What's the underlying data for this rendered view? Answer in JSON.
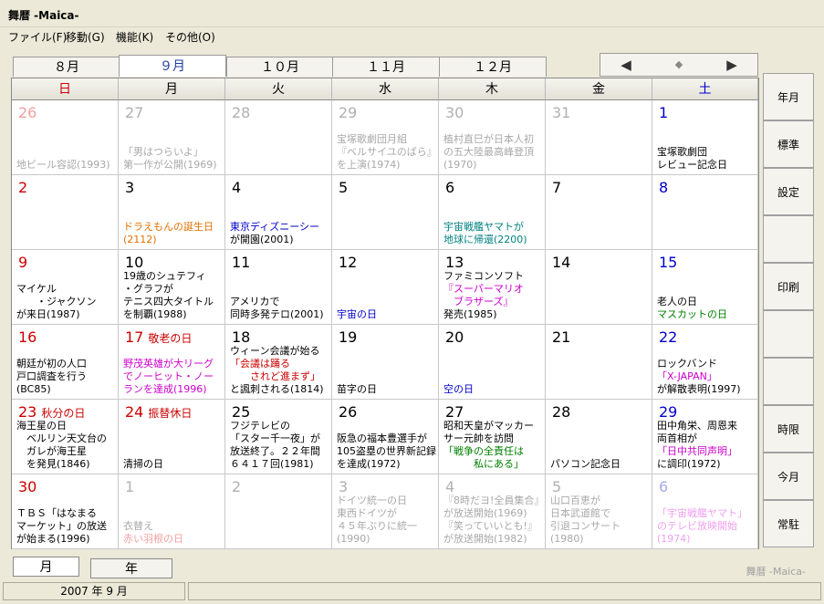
{
  "window": {
    "title": "舞暦 -Maica-"
  },
  "menu": [
    "ファイル(F)",
    "移動(G)",
    "機能(K)",
    "その他(O)"
  ],
  "month_tabs": [
    "８月",
    "９月",
    "１０月",
    "１１月",
    "１２月"
  ],
  "active_month_index": 1,
  "nav": {
    "prev": "◀",
    "updown": "◆",
    "next": "▶"
  },
  "weekdays": [
    "日",
    "月",
    "火",
    "水",
    "木",
    "金",
    "土"
  ],
  "weekday_colors": [
    "#cc0000",
    "#000000",
    "#000000",
    "#000000",
    "#000000",
    "#000000",
    "#0000cc"
  ],
  "cells": [
    {
      "day": "26",
      "label": "",
      "dim": true,
      "numcolor": "#f0a0a0",
      "events": [
        {
          "text": "地ビール容認(1993)",
          "color": "#a8a8a8"
        }
      ]
    },
    {
      "day": "27",
      "label": "",
      "dim": true,
      "numcolor": "#b0b0b0",
      "events": [
        {
          "text": "「男はつらいよ」\n第一作が公開(1969)",
          "color": "#a8a8a8"
        }
      ]
    },
    {
      "day": "28",
      "label": "",
      "dim": true,
      "numcolor": "#b0b0b0",
      "events": []
    },
    {
      "day": "29",
      "label": "",
      "dim": true,
      "numcolor": "#b0b0b0",
      "events": [
        {
          "text": "宝塚歌劇団月組\n『ベルサイユのばら』\nを上演(1974)",
          "color": "#a8a8a8"
        }
      ]
    },
    {
      "day": "30",
      "label": "",
      "dim": true,
      "numcolor": "#b0b0b0",
      "events": [
        {
          "text": "植村直巳が日本人初\nの五大陸最高峰登頂\n(1970)",
          "color": "#a8a8a8"
        }
      ]
    },
    {
      "day": "31",
      "label": "",
      "dim": true,
      "numcolor": "#b0b0b0",
      "events": []
    },
    {
      "day": "1",
      "label": "",
      "dim": false,
      "numcolor": "#0000cc",
      "events": [
        {
          "text": "宝塚歌劇団\nレビュー記念日",
          "color": "#000000"
        }
      ]
    },
    {
      "day": "2",
      "label": "",
      "dim": false,
      "numcolor": "#cc0000",
      "events": []
    },
    {
      "day": "3",
      "label": "",
      "dim": false,
      "numcolor": "#000000",
      "events": [
        {
          "text": "ドラえもんの誕生日\n(2112)",
          "color": "#e07000"
        }
      ]
    },
    {
      "day": "4",
      "label": "",
      "dim": false,
      "numcolor": "#000000",
      "events": [
        {
          "text": "東京ディズニーシー",
          "color": "#0000cc"
        },
        {
          "text": "が開園(2001)",
          "color": "#000000"
        }
      ]
    },
    {
      "day": "5",
      "label": "",
      "dim": false,
      "numcolor": "#000000",
      "events": []
    },
    {
      "day": "6",
      "label": "",
      "dim": false,
      "numcolor": "#000000",
      "events": [
        {
          "text": "宇宙戦艦ヤマトが\n地球に帰還(2200)",
          "color": "#008080"
        }
      ]
    },
    {
      "day": "7",
      "label": "",
      "dim": false,
      "numcolor": "#000000",
      "events": []
    },
    {
      "day": "8",
      "label": "",
      "dim": false,
      "numcolor": "#0000cc",
      "events": []
    },
    {
      "day": "9",
      "label": "",
      "dim": false,
      "numcolor": "#cc0000",
      "events": [
        {
          "text": "マイケル\n　　・ジャクソン\nが来日(1987)",
          "color": "#000000"
        }
      ]
    },
    {
      "day": "10",
      "label": "",
      "dim": false,
      "numcolor": "#000000",
      "events": [
        {
          "text": "19歳のシュテフィ\n・グラフが\nテニス四大タイトル\nを制覇(1988)",
          "color": "#000000"
        }
      ]
    },
    {
      "day": "11",
      "label": "",
      "dim": false,
      "numcolor": "#000000",
      "events": [
        {
          "text": "アメリカで\n同時多発テロ(2001)",
          "color": "#000000"
        }
      ]
    },
    {
      "day": "12",
      "label": "",
      "dim": false,
      "numcolor": "#000000",
      "events": [
        {
          "text": "宇宙の日",
          "color": "#0000cc"
        }
      ]
    },
    {
      "day": "13",
      "label": "",
      "dim": false,
      "numcolor": "#000000",
      "events": [
        {
          "text": "ファミコンソフト",
          "color": "#000000"
        },
        {
          "text": "『スーパーマリオ\n　ブラザーズ』",
          "color": "#cc00cc"
        },
        {
          "text": "発売(1985)",
          "color": "#000000"
        }
      ]
    },
    {
      "day": "14",
      "label": "",
      "dim": false,
      "numcolor": "#000000",
      "events": []
    },
    {
      "day": "15",
      "label": "",
      "dim": false,
      "numcolor": "#0000cc",
      "events": [
        {
          "text": "老人の日",
          "color": "#000000"
        },
        {
          "text": "マスカットの日",
          "color": "#008000"
        }
      ]
    },
    {
      "day": "16",
      "label": "",
      "dim": false,
      "numcolor": "#cc0000",
      "events": [
        {
          "text": "朝廷が初の人口\n戸口調査を行う\n(BC85)",
          "color": "#000000"
        }
      ]
    },
    {
      "day": "17",
      "label": "敬老の日",
      "dim": false,
      "numcolor": "#cc0000",
      "events": [
        {
          "text": "野茂英雄が大リーグ\nでノーヒット・ノー\nランを達成(1996)",
          "color": "#cc00cc"
        }
      ]
    },
    {
      "day": "18",
      "label": "",
      "dim": false,
      "numcolor": "#000000",
      "events": [
        {
          "text": "ウィーン会議が始る",
          "color": "#000000"
        },
        {
          "text": "「会議は踊る\n　　されど進まず」",
          "color": "#cc0000"
        },
        {
          "text": "と諷刺される(1814)",
          "color": "#000000"
        }
      ]
    },
    {
      "day": "19",
      "label": "",
      "dim": false,
      "numcolor": "#000000",
      "events": [
        {
          "text": "苗字の日",
          "color": "#000000"
        }
      ]
    },
    {
      "day": "20",
      "label": "",
      "dim": false,
      "numcolor": "#000000",
      "events": [
        {
          "text": "空の日",
          "color": "#0000cc"
        }
      ]
    },
    {
      "day": "21",
      "label": "",
      "dim": false,
      "numcolor": "#000000",
      "events": []
    },
    {
      "day": "22",
      "label": "",
      "dim": false,
      "numcolor": "#0000cc",
      "events": [
        {
          "text": "ロックバンド",
          "color": "#000000"
        },
        {
          "text": "「X-JAPAN」",
          "color": "#cc00cc"
        },
        {
          "text": "が解散表明(1997)",
          "color": "#000000"
        }
      ]
    },
    {
      "day": "23",
      "label": "秋分の日",
      "dim": false,
      "numcolor": "#cc0000",
      "events": [
        {
          "text": "海王星の日\n　ベルリン天文台の\n　ガレが海王星\n　を発見(1846)",
          "color": "#000000"
        }
      ]
    },
    {
      "day": "24",
      "label": "振替休日",
      "dim": false,
      "numcolor": "#cc0000",
      "events": [
        {
          "text": "清掃の日",
          "color": "#000000"
        }
      ]
    },
    {
      "day": "25",
      "label": "",
      "dim": false,
      "numcolor": "#000000",
      "events": [
        {
          "text": "フジテレビの\n「スター千一夜」が\n放送終了。２２年間\n６４１７回(1981)",
          "color": "#000000"
        }
      ]
    },
    {
      "day": "26",
      "label": "",
      "dim": false,
      "numcolor": "#000000",
      "events": [
        {
          "text": "阪急の福本豊選手が\n105盗塁の世界新記録\nを達成(1972)",
          "color": "#000000"
        }
      ]
    },
    {
      "day": "27",
      "label": "",
      "dim": false,
      "numcolor": "#000000",
      "events": [
        {
          "text": "昭和天皇がマッカー\nサー元帥を訪問",
          "color": "#000000"
        },
        {
          "text": "「戦争の全責任は\n　　　私にある」",
          "color": "#008000"
        }
      ]
    },
    {
      "day": "28",
      "label": "",
      "dim": false,
      "numcolor": "#000000",
      "events": [
        {
          "text": "パソコン記念日",
          "color": "#000000"
        }
      ]
    },
    {
      "day": "29",
      "label": "",
      "dim": false,
      "numcolor": "#0000cc",
      "events": [
        {
          "text": "田中角栄、周恩来\n両首相が",
          "color": "#000000"
        },
        {
          "text": "「日中共同声明」",
          "color": "#cc00cc"
        },
        {
          "text": "に調印(1972)",
          "color": "#000000"
        }
      ]
    },
    {
      "day": "30",
      "label": "",
      "dim": false,
      "numcolor": "#cc0000",
      "events": [
        {
          "text": "ＴＢＳ「はなまる\nマーケット」の放送\nが始まる(1996)",
          "color": "#000000"
        }
      ]
    },
    {
      "day": "1",
      "label": "",
      "dim": true,
      "numcolor": "#b0b0b0",
      "events": [
        {
          "text": "衣替え",
          "color": "#a8a8a8"
        },
        {
          "text": "赤い羽根の日",
          "color": "#f0a0a0"
        }
      ]
    },
    {
      "day": "2",
      "label": "",
      "dim": true,
      "numcolor": "#b0b0b0",
      "events": []
    },
    {
      "day": "3",
      "label": "",
      "dim": true,
      "numcolor": "#b0b0b0",
      "events": [
        {
          "text": "ドイツ統一の日\n東西ドイツが\n４５年ぶりに統一\n(1990)",
          "color": "#a8a8a8"
        }
      ]
    },
    {
      "day": "4",
      "label": "",
      "dim": true,
      "numcolor": "#b0b0b0",
      "events": [
        {
          "text": "『8時だヨ!全員集合』\nが放送開始(1969)\n『笑っていいとも!』\nが放送開始(1982)",
          "color": "#a8a8a8"
        }
      ]
    },
    {
      "day": "5",
      "label": "",
      "dim": true,
      "numcolor": "#b0b0b0",
      "events": [
        {
          "text": "山口百恵が\n日本武道館で\n引退コンサート\n(1980)",
          "color": "#a8a8a8"
        }
      ]
    },
    {
      "day": "6",
      "label": "",
      "dim": true,
      "numcolor": "#a8a8f0",
      "events": [
        {
          "text": "「宇宙戦艦ヤマト」\nのテレビ放映開始\n(1974)",
          "color": "#f0a0f0"
        }
      ]
    }
  ],
  "sidebar": [
    "年月",
    "標準",
    "設定",
    "",
    "印刷",
    "",
    "",
    "時限",
    "今月",
    "常駐"
  ],
  "bottom_tabs": [
    "月",
    "年"
  ],
  "active_bottom_tab": 0,
  "status": {
    "date": "2007 年 9 月",
    "watermark": "舞暦 -Maica-"
  }
}
